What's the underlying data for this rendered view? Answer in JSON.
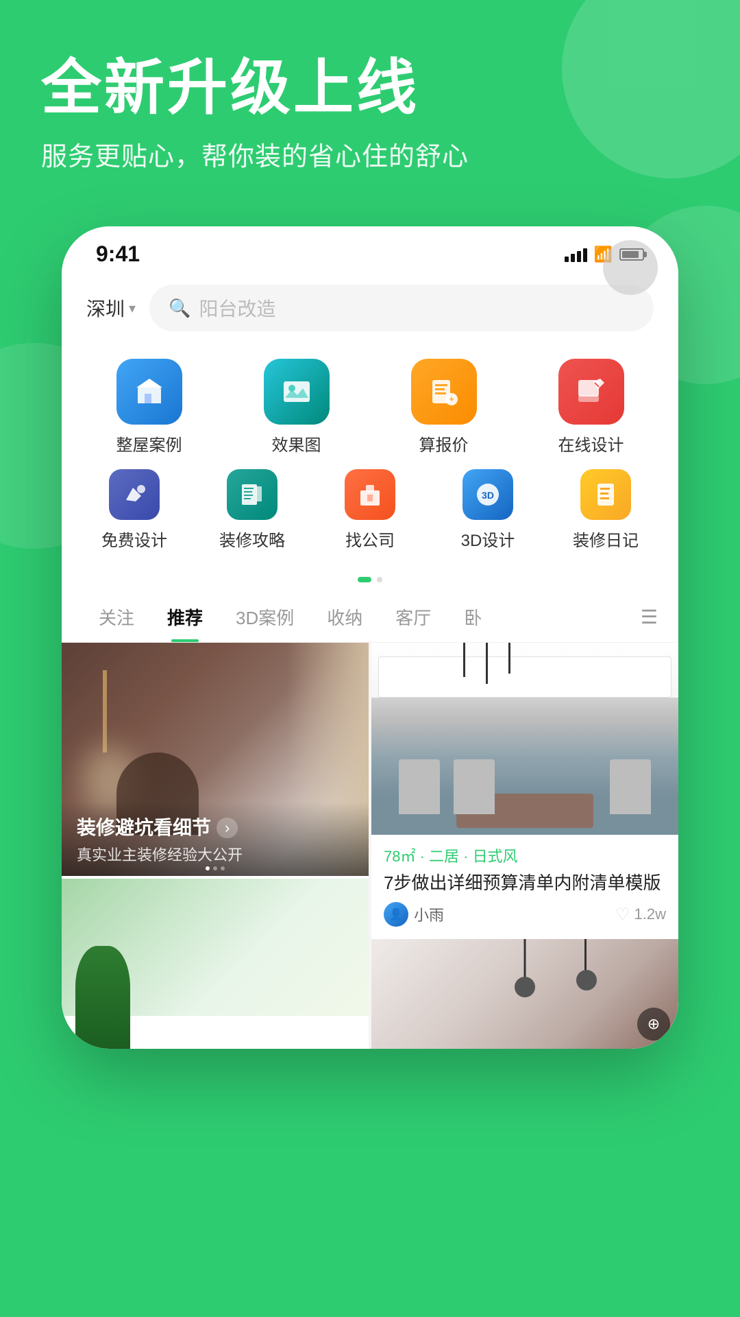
{
  "hero": {
    "title": "全新升级上线",
    "subtitle": "服务更贴心，帮你装的省心住的舒心"
  },
  "statusBar": {
    "time": "9:41"
  },
  "search": {
    "location": "深圳",
    "placeholder": "阳台改造"
  },
  "iconGrid": {
    "row1": [
      {
        "label": "整屋案例",
        "icon": "🏠",
        "color": "icon-blue"
      },
      {
        "label": "效果图",
        "icon": "🖼️",
        "color": "icon-green"
      },
      {
        "label": "算报价",
        "icon": "🧮",
        "color": "icon-orange"
      },
      {
        "label": "在线设计",
        "icon": "✏️",
        "color": "icon-red-orange"
      }
    ],
    "row2": [
      {
        "label": "免费设计",
        "icon": "🎨",
        "color": "icon-blue-light"
      },
      {
        "label": "装修攻略",
        "icon": "📋",
        "color": "icon-teal"
      },
      {
        "label": "找公司",
        "icon": "🏢",
        "color": "icon-coral"
      },
      {
        "label": "3D设计",
        "icon": "3D",
        "color": "icon-blue3d"
      },
      {
        "label": "装修日记",
        "icon": "📓",
        "color": "icon-amber"
      }
    ]
  },
  "tabs": [
    {
      "label": "关注",
      "active": false
    },
    {
      "label": "推荐",
      "active": true
    },
    {
      "label": "3D案例",
      "active": false
    },
    {
      "label": "收纳",
      "active": false
    },
    {
      "label": "客厅",
      "active": false
    },
    {
      "label": "卧",
      "active": false
    }
  ],
  "cards": {
    "featured": {
      "title": "装修避坑看细节",
      "subtitle": "真实业主装修经验大公开"
    },
    "right": {
      "tag": "78㎡ · 二居 · 日式风",
      "title": "7步做出详细预算清单内附清单模版",
      "author": "小雨",
      "likes": "1.2w"
    }
  }
}
